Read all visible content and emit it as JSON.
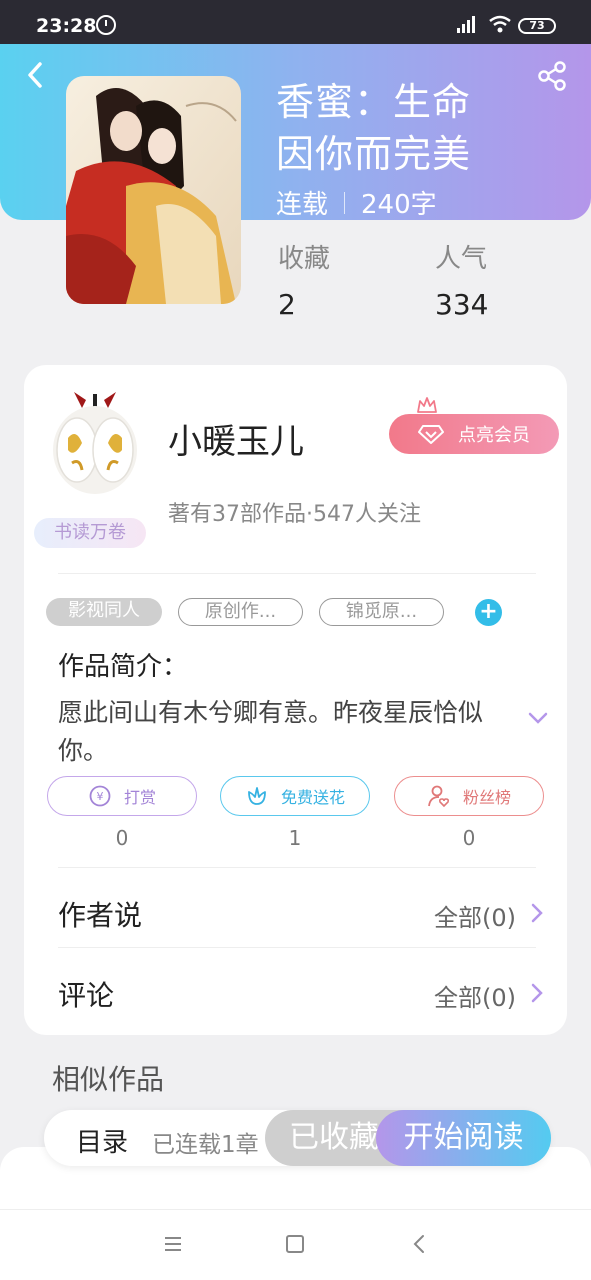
{
  "status_bar": {
    "time": "23:28",
    "battery": "73"
  },
  "book": {
    "title": "香蜜：生命因你而完美",
    "status": "连载",
    "word_count": "240字",
    "stats": [
      {
        "label": "收藏",
        "value": "2"
      },
      {
        "label": "人气",
        "value": "334"
      }
    ]
  },
  "author": {
    "name": "小暖玉儿",
    "badge": "书读万卷",
    "stats_text": "著有37部作品·547人关注",
    "vip_button": "点亮会员"
  },
  "tags": [
    "影视同人",
    "原创作...",
    "锦觅原...",
    "+"
  ],
  "intro": {
    "title": "作品简介：",
    "text": "愿此间山有木兮卿有意。昨夜星辰恰似你。"
  },
  "actions": [
    {
      "label": "打赏",
      "count": "0"
    },
    {
      "label": "免费送花",
      "count": "1"
    },
    {
      "label": "粉丝榜",
      "count": "0"
    }
  ],
  "rows": [
    {
      "label": "作者说",
      "value": "全部(0)"
    },
    {
      "label": "评论",
      "value": "全部(0)"
    }
  ],
  "similar_title": "相似作品",
  "bottom_bar": {
    "toc_label": "目录",
    "toc_progress": "已连载1章",
    "collected": "已收藏",
    "read": "开始阅读"
  },
  "colors": {
    "header_start": "#5ad1f0",
    "header_end": "#b496ea",
    "accent_blue": "#33bde8",
    "vip_pink": "#f2798a"
  }
}
